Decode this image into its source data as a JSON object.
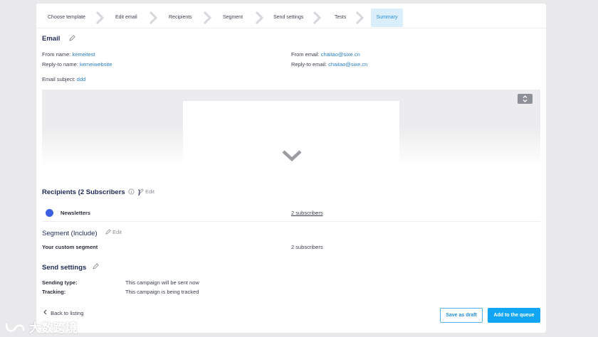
{
  "steps": [
    {
      "label": "Choose template",
      "active": false
    },
    {
      "label": "Edit email",
      "active": false
    },
    {
      "label": "Recipients",
      "active": false
    },
    {
      "label": "Segment",
      "active": false
    },
    {
      "label": "Send settings",
      "active": false
    },
    {
      "label": "Tests",
      "active": false
    },
    {
      "label": "Summary",
      "active": true
    }
  ],
  "email": {
    "title": "Email",
    "from_name_label": "From name:",
    "from_name": "kemeitest",
    "reply_name_label": "Reply-to name:",
    "reply_name": "kemeiwebsite",
    "from_email_label": "From email:",
    "from_email": "chaitao@sixe.cn",
    "reply_email_label": "Reply-to email:",
    "reply_email": "chaitao@sixe.cn",
    "subject_label": "Email subject:",
    "subject": "ddd"
  },
  "preview": {
    "expand_icon": "expand-icon",
    "more_icon": "chevron-down-icon"
  },
  "recipients": {
    "title": "Recipients (2 Subscribers",
    "title_close": ")",
    "edit_label": "Edit",
    "list_name": "Newsletters",
    "list_count": "2 subscribers",
    "dot_color": "#3b5fe0"
  },
  "segment": {
    "title": "Segment (Include)",
    "edit_label": "Edit",
    "name": "Your custom segment",
    "count": "2 subscribers"
  },
  "send_settings": {
    "title": "Send settings",
    "sending_type_label": "Sending type:",
    "sending_type": "This campaign will be sent now",
    "tracking_label": "Tracking:",
    "tracking": "This campaign is being tracked"
  },
  "footer": {
    "back_label": "Back to listing",
    "draft_label": "Save as draft",
    "queue_label": "Add to the queue"
  },
  "watermark": "大数跨境",
  "colors": {
    "accent": "#11a6f5",
    "link": "#2a7fc6",
    "heading": "#1e2a55"
  }
}
